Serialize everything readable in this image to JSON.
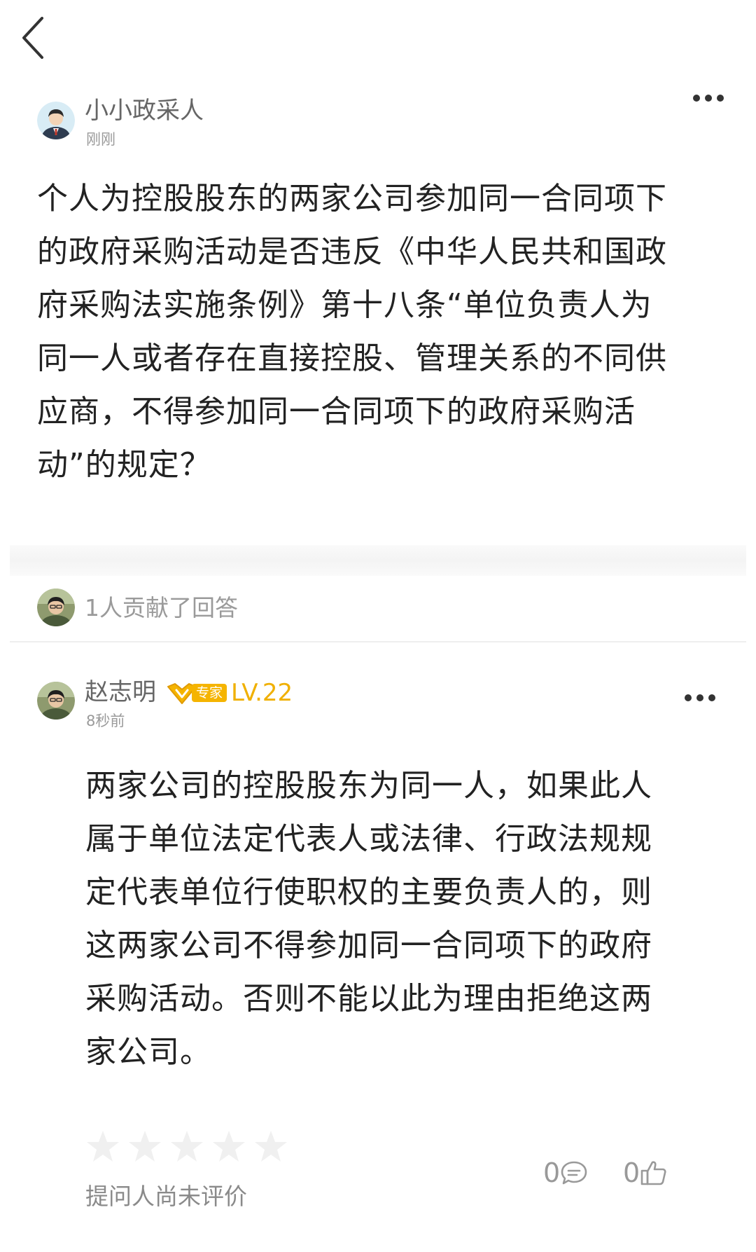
{
  "question": {
    "author": "小小政采人",
    "time": "刚刚",
    "lines": [
      "个人为控股股东的两家公司参加同一合同项下",
      "的政府采购活动是否违反《中华人民共和国政",
      "府采购法实施条例》第十八条“单位负责人为",
      "同一人或者存在直接控股、管理关系的不同供",
      "应商，不得参加同一合同项下的政府采购活",
      "动”的规定？"
    ]
  },
  "contributors": {
    "text": "1人贡献了回答"
  },
  "answer": {
    "author": "赵志明",
    "badge_label": "专家",
    "level": "LV.22",
    "time": "8秒前",
    "lines": [
      "两家公司的控股股东为同一人，如果此人",
      "属于单位法定代表人或法律、行政法规规",
      "定代表单位行使职权的主要负责人的，则",
      "这两家公司不得参加同一合同项下的政府",
      "采购活动。否则不能以此为理由拒绝这两",
      "家公司。"
    ],
    "rating_text": "提问人尚未评价",
    "star_rating": 0,
    "comment_count": "0",
    "like_count": "0"
  },
  "colors": {
    "badge": "#f5b400",
    "level": "#f0b000",
    "muted": "#9a9a9a"
  }
}
